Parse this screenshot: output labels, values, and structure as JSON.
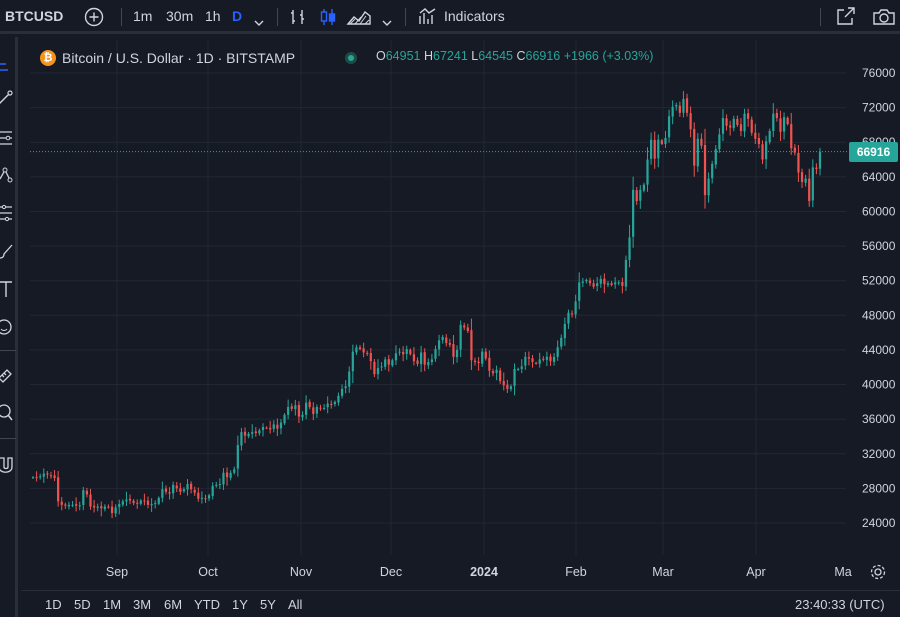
{
  "toolbar": {
    "symbol": "BTCUSD",
    "intervals": [
      "1m",
      "30m",
      "1h",
      "D"
    ],
    "active_interval": "D",
    "indicators_label": "Indicators"
  },
  "legend": {
    "title": "Bitcoin / U.S. Dollar · 1D · BITSTAMP",
    "coin_glyph": "₿",
    "o_label": "O",
    "o_value": "64951",
    "h_label": "H",
    "h_value": "67241",
    "l_label": "L",
    "l_value": "64545",
    "c_label": "C",
    "c_value": "66916",
    "change": "+1966 (+3.03%)"
  },
  "price_scale": {
    "ticks": [
      "76000",
      "72000",
      "68000",
      "64000",
      "60000",
      "56000",
      "52000",
      "48000",
      "44000",
      "40000",
      "36000",
      "32000",
      "28000",
      "24000"
    ],
    "last_price": "66916"
  },
  "time_scale": {
    "ticks": [
      "Sep",
      "Oct",
      "Nov",
      "Dec",
      "2024",
      "Feb",
      "Mar",
      "Apr",
      "Ma"
    ]
  },
  "bottom": {
    "ranges": [
      "1D",
      "5D",
      "1M",
      "3M",
      "6M",
      "YTD",
      "1Y",
      "5Y",
      "All"
    ],
    "clock": "23:40:33 (UTC)"
  },
  "colors": {
    "up": "#26a69a",
    "down": "#ef5350",
    "background": "#161a25",
    "grid": "#232733",
    "accent": "#2962ff"
  },
  "chart_data": {
    "type": "candlestick",
    "title": "Bitcoin / U.S. Dollar · 1D · BITSTAMP",
    "y_range": [
      22000,
      78000
    ],
    "x_range": [
      "2023-08-15",
      "2024-05-01"
    ],
    "series": [
      {
        "name": "BTCUSD",
        "closes": [
          29300,
          29200,
          29400,
          29700,
          29600,
          29500,
          29200,
          26500,
          26100,
          26000,
          26100,
          26100,
          26000,
          26050,
          27800,
          27300,
          25900,
          25800,
          25900,
          25700,
          25900,
          25800,
          25150,
          25800,
          26200,
          26500,
          26700,
          26600,
          26300,
          26300,
          26600,
          26500,
          26100,
          26200,
          26300,
          26900,
          27900,
          27600,
          27400,
          28400,
          28000,
          27600,
          27900,
          28500,
          27900,
          27500,
          26800,
          26900,
          26800,
          27200,
          28300,
          28400,
          28500,
          29800,
          29300,
          29800,
          30200,
          33000,
          34500,
          34100,
          34300,
          34500,
          34400,
          34700,
          35100,
          35000,
          34800,
          35400,
          34900,
          35600,
          36500,
          37400,
          37200,
          37600,
          36300,
          36500,
          37900,
          37400,
          36600,
          37400,
          37300,
          37300,
          37800,
          37700,
          38000,
          38700,
          39500,
          39800,
          41500,
          43800,
          44300,
          44100,
          43700,
          43600,
          42700,
          41200,
          41900,
          42100,
          42900,
          42300,
          42800,
          43600,
          43800,
          43500,
          44100,
          43500,
          42700,
          42400,
          43700,
          42300,
          42600,
          42900,
          44100,
          45100,
          45500,
          44800,
          44600,
          43200,
          44000,
          46900,
          46600,
          46200,
          42800,
          42600,
          42500,
          43800,
          43000,
          41600,
          41300,
          41700,
          40400,
          39900,
          39500,
          39800,
          41800,
          41800,
          42100,
          43200,
          43000,
          42600,
          42400,
          42900,
          42900,
          43200,
          42700,
          43200,
          44300,
          45400,
          47000,
          48300,
          48100,
          49600,
          51800,
          51900,
          52100,
          51700,
          51300,
          51700,
          52200,
          51600,
          51700,
          51500,
          51800,
          51800,
          51400,
          54400,
          57000,
          62500,
          61200,
          62500,
          63100,
          66000,
          68300,
          66100,
          68300,
          67800,
          68500,
          71000,
          72100,
          72300,
          71400,
          73000,
          71400,
          69500,
          65300,
          68400,
          67600,
          61900,
          63800,
          65500,
          67200,
          68900,
          70800,
          69900,
          69700,
          70700,
          70000,
          69300,
          71300,
          70700,
          69100,
          68400,
          67800,
          66000,
          68100,
          69300,
          71300,
          70800,
          69200,
          70900,
          70100,
          67300,
          66800,
          64500,
          63400,
          63800,
          61200,
          65100,
          64900,
          66900
        ]
      }
    ],
    "last_price": 66916
  }
}
